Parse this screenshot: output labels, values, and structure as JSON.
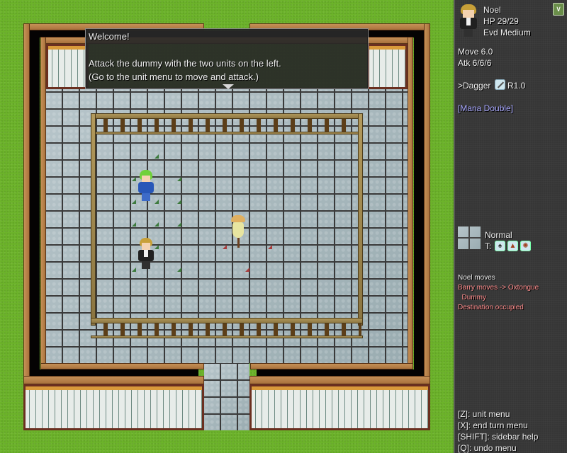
{
  "message_box": {
    "title": "Welcome!",
    "line1": "",
    "line2": "Attack the dummy with the two units on the left.",
    "line3": "(Go to the unit menu to move and attack.)",
    "continue_icon": "down-triangle-icon"
  },
  "units": [
    {
      "name": "Barry",
      "sprite": "green-haired-blue-armor-unit",
      "team": "player"
    },
    {
      "name": "Noel",
      "sprite": "blonde-black-suit-unit",
      "team": "player"
    },
    {
      "name": "Dummy",
      "sprite": "scarecrow-dummy",
      "team": "enemy"
    }
  ],
  "sidebar": {
    "unit": {
      "name": "Noel",
      "hp": "HP 29/29",
      "evasion": "Evd Medium",
      "move": "Move 6.0",
      "attack": "Atk 6/6/6",
      "weapon_label": ">Dagger",
      "weapon_icon": "dagger-icon",
      "weapon_range": "R1.0",
      "skill": "[Mana Double]",
      "skill_color": "#a8a8ff",
      "collapse_icon": "chevron-down-icon"
    },
    "terrain": {
      "name": "Normal",
      "types_label": "T:",
      "type_icons": [
        "shovel-icon",
        "rubble-icon",
        "burst-icon"
      ]
    },
    "log": [
      {
        "text": "Noel moves",
        "color": "#e8e8e8"
      },
      {
        "text": "Barry moves -> Oxtongue",
        "color": "#ff8c8c"
      },
      {
        "text": "  Dummy",
        "color": "#ff8c8c"
      },
      {
        "text": "Destination occupied",
        "color": "#ff8c8c"
      }
    ],
    "help": [
      "[Z]: unit menu",
      "[X]: end turn menu",
      "[SHIFT]: sidebar help",
      "[Q]: undo menu"
    ]
  }
}
